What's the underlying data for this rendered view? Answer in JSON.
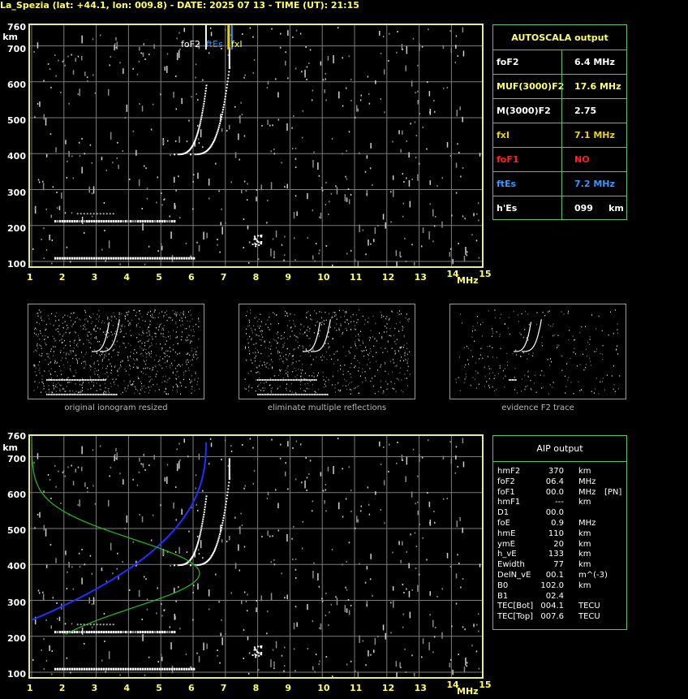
{
  "header": {
    "title": "La_Spezia (lat: +44.1, lon: 009.8) - DATE: 2025 07 13 - TIME (UT): 21:15"
  },
  "top_plot": {
    "y_unit": "km",
    "x_unit": "MHz",
    "y_ticks": [
      "760",
      "700",
      "600",
      "500",
      "400",
      "300",
      "200",
      "100"
    ],
    "x_ticks": [
      "1",
      "2",
      "3",
      "4",
      "5",
      "6",
      "7",
      "8",
      "9",
      "10",
      "11",
      "12",
      "13",
      "14",
      "15"
    ],
    "markers": [
      {
        "label": "foF2",
        "color": "#ffffff"
      },
      {
        "label": "ftEs",
        "color": "#3399ff"
      },
      {
        "label": "fxI",
        "color": "#e8d020"
      }
    ]
  },
  "autoscala": {
    "title": "AUTOSCALA output",
    "rows": [
      {
        "name": "foF2",
        "value": "6.4 MHz",
        "name_color": "#ffffff",
        "value_color": "#ffffff"
      },
      {
        "name": "MUF(3000)F2",
        "value": "17.6 MHz",
        "name_color": "#ffff66",
        "value_color": "#ffff66"
      },
      {
        "name": "M(3000)F2",
        "value": "2.75",
        "name_color": "#ffffff",
        "value_color": "#ffffff"
      },
      {
        "name": "fxI",
        "value": "7.1 MHz",
        "name_color": "#e8d020",
        "value_color": "#e8d020"
      },
      {
        "name": "foF1",
        "value": "NO",
        "name_color": "#ff2020",
        "value_color": "#ff2020"
      },
      {
        "name": "ftEs",
        "value": "7.2 MHz",
        "name_color": "#3399ff",
        "value_color": "#3399ff"
      },
      {
        "name": "h'Es",
        "value": "099     km",
        "name_color": "#ffffff",
        "value_color": "#ffffff"
      }
    ]
  },
  "thumbnails": [
    {
      "caption": "original ionogram resized"
    },
    {
      "caption": "eliminate multiple reflections"
    },
    {
      "caption": "evidence F2 trace"
    }
  ],
  "bottom_plot": {
    "y_unit": "km",
    "x_unit": "MHz",
    "y_ticks": [
      "760",
      "700",
      "600",
      "500",
      "400",
      "300",
      "200",
      "100"
    ],
    "x_ticks": [
      "1",
      "2",
      "3",
      "4",
      "5",
      "6",
      "7",
      "8",
      "9",
      "10",
      "11",
      "12",
      "13",
      "14",
      "15"
    ]
  },
  "aip": {
    "title": "AIP output",
    "rows": [
      [
        "hmF2",
        "370",
        "km",
        ""
      ],
      [
        "foF2",
        "06.4",
        "MHz",
        ""
      ],
      [
        "foF1",
        "00.0",
        "MHz",
        "[PN]"
      ],
      [
        "hmF1",
        "---",
        "km",
        ""
      ],
      [
        "D1",
        "00.0",
        "",
        ""
      ],
      [
        "foE",
        "0.9",
        "MHz",
        ""
      ],
      [
        "hmE",
        "110",
        "km",
        ""
      ],
      [
        "ymE",
        "20",
        "km",
        ""
      ],
      [
        "h_vE",
        "133",
        "km",
        ""
      ],
      [
        "Ewidth",
        "77",
        "km",
        ""
      ],
      [
        "DelN_vE",
        "00.1",
        "m^(-3)",
        ""
      ],
      [
        "B0",
        "102.0",
        "km",
        ""
      ],
      [
        "B1",
        "02.4",
        "",
        ""
      ],
      [
        "TEC[Bot]",
        "004.1",
        "TECU",
        ""
      ],
      [
        "TEC[Top]",
        "007.6",
        "TECU",
        ""
      ]
    ]
  },
  "colors": {
    "axis_text": "#ffff66",
    "frame": "#e8e8a0",
    "grid": "#7a7a7a",
    "panel_border": "#60c060",
    "profile_blue": "#2030ff",
    "profile_green": "#20c020"
  }
}
